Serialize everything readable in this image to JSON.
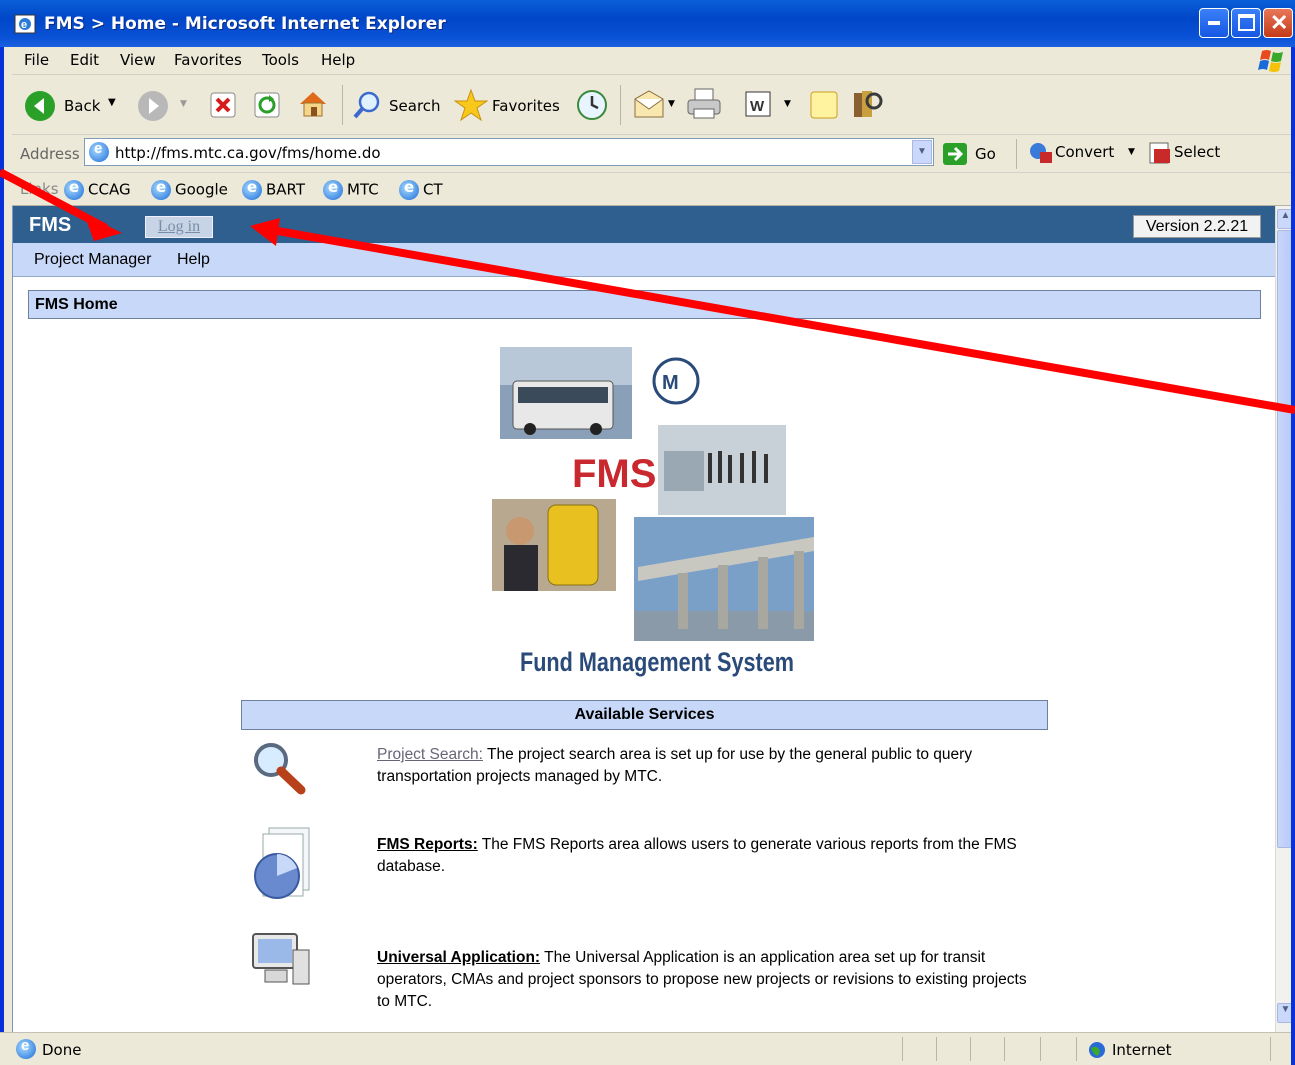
{
  "window": {
    "title": "FMS  >  Home - Microsoft Internet Explorer"
  },
  "menu": {
    "items": [
      "File",
      "Edit",
      "View",
      "Favorites",
      "Tools",
      "Help"
    ]
  },
  "toolbar": {
    "back": "Back",
    "search": "Search",
    "favorites": "Favorites"
  },
  "address": {
    "label": "Address",
    "url": "http://fms.mtc.ca.gov/fms/home.do",
    "go": "Go",
    "convert": "Convert",
    "select": "Select"
  },
  "links": {
    "label": "Links",
    "items": [
      "CCAG",
      "Google",
      "BART",
      "MTC",
      "CT"
    ]
  },
  "app": {
    "brand": "FMS",
    "login": "Log in",
    "version": "Version 2.2.21",
    "nav": [
      "Project Manager",
      "Help"
    ],
    "page_title": "FMS Home",
    "logo_text": "FMS",
    "logo_caption": "Fund Management System",
    "mtc_logo": "M",
    "services_header": "Available Services",
    "services": [
      {
        "title": "Project Search:",
        "text": " The project search area is set up for use by the general public to query transportation projects managed by MTC.",
        "icon": "magnifier-icon"
      },
      {
        "title": "FMS Reports:",
        "text": " The FMS Reports area allows users to generate various reports from the FMS database.",
        "icon": "report-chart-icon"
      },
      {
        "title": "Universal Application:",
        "text": " The Universal Application is an application area set up for transit operators, CMAs and project sponsors to propose new projects or revisions to existing projects to MTC.",
        "icon": "computer-icon"
      }
    ]
  },
  "status": {
    "left": "Done",
    "zone": "Internet"
  },
  "colors": {
    "title_bar": "#0a5fd8",
    "fms_bar": "#2f5f8f",
    "nav_bar": "#c8d8f8",
    "arrow": "#ff0000",
    "logo_red": "#c8282e",
    "logo_blue": "#2a4a7a"
  }
}
